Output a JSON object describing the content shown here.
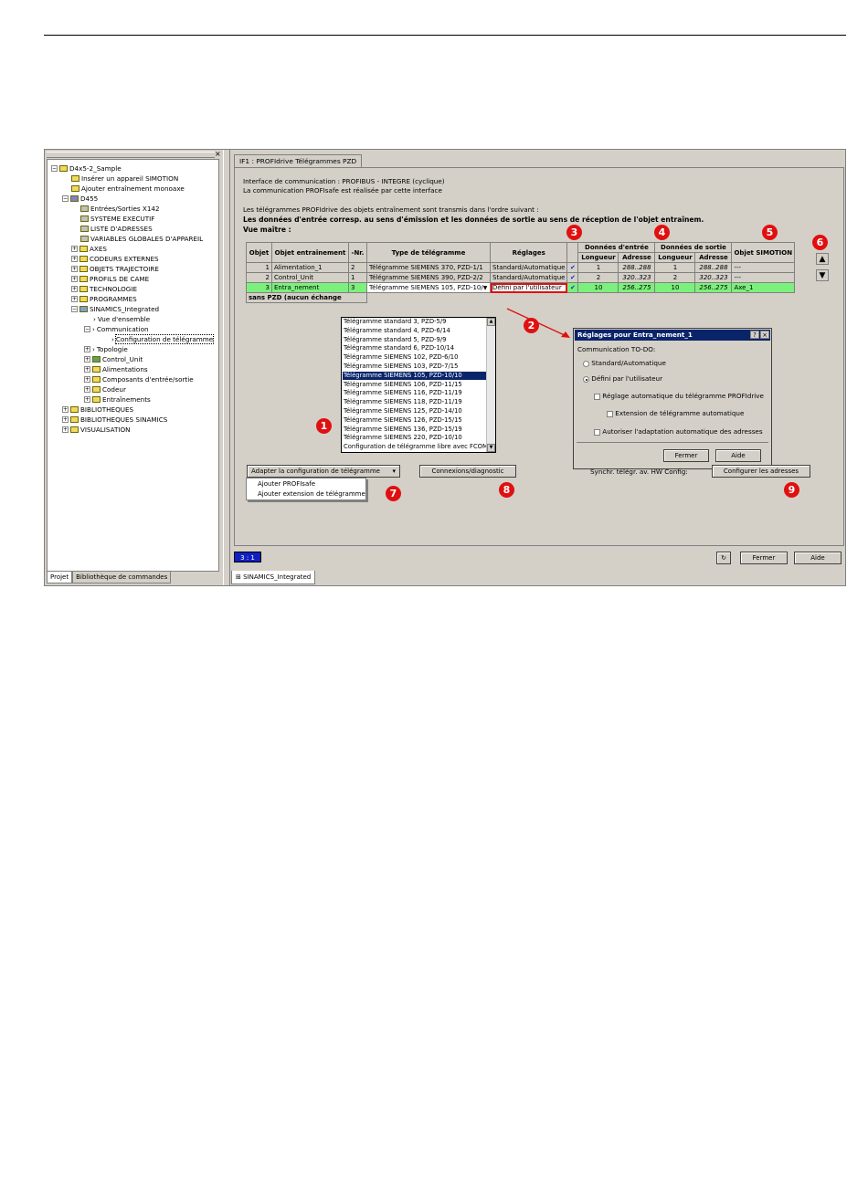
{
  "tree": {
    "items": [
      {
        "label": "D4x5-2_Sample"
      },
      {
        "label": "Insérer un appareil SIMOTION"
      },
      {
        "label": "Ajouter entraînement monoaxe"
      },
      {
        "label": "D455"
      },
      {
        "label": "Entrées/Sorties X142"
      },
      {
        "label": "SYSTEME EXECUTIF"
      },
      {
        "label": "LISTE D'ADRESSES"
      },
      {
        "label": "VARIABLES GLOBALES D'APPAREIL"
      },
      {
        "label": "AXES"
      },
      {
        "label": "CODEURS EXTERNES"
      },
      {
        "label": "OBJETS TRAJECTOIRE"
      },
      {
        "label": "PROFILS DE CAME"
      },
      {
        "label": "TECHNOLOGIE"
      },
      {
        "label": "PROGRAMMES"
      },
      {
        "label": "SINAMICS_Integrated"
      },
      {
        "label": "Vue d'ensemble"
      },
      {
        "label": "Communication"
      },
      {
        "label": "Configuration de télégramme"
      },
      {
        "label": "Topologie"
      },
      {
        "label": "Control_Unit"
      },
      {
        "label": "Alimentations"
      },
      {
        "label": "Composants d'entrée/sortie"
      },
      {
        "label": "Codeur"
      },
      {
        "label": "Entraînements"
      },
      {
        "label": "BIBLIOTHEQUES"
      },
      {
        "label": "BIBLIOTHEQUES SINAMICS"
      },
      {
        "label": "VISUALISATION"
      }
    ],
    "tabs": [
      "Projet",
      "Bibliothèque de commandes"
    ]
  },
  "right": {
    "tab_label": "IF1 : PROFIdrive Télégrammes PZD",
    "info1": "Interface de communication : PROFIBUS - INTEGRE (cyclique)",
    "info2": "La communication PROFIsafe est réalisée par cette interface",
    "info3": "Les télégrammes PROFIdrive des objets entraînement sont transmis dans l'ordre suivant :",
    "info4": "Les données d'entrée corresp. au sens d'émission et les données de sortie au sens de réception de l'objet entraînem.",
    "info5": "Vue maître :"
  },
  "table": {
    "headers": {
      "objet": "Objet",
      "objet_entr": "Objet entraînement",
      "nr": "-Nr.",
      "type": "Type de télégramme",
      "reglages": "Réglages",
      "donnees_entree": "Données d'entrée",
      "donnees_sortie": "Données de sortie",
      "longueur": "Longueur",
      "adresse": "Adresse",
      "objet_simotion": "Objet SIMOTION"
    },
    "rows": [
      {
        "objet": "1",
        "objet_entr": "Alimentation_1",
        "nr": "2",
        "type": "Télégramme SIEMENS 370, PZD-1/1",
        "reglages": "Standard/Automatique",
        "check": "✔",
        "lin": "1",
        "ain": "288..288",
        "lout": "1",
        "aout": "288..288",
        "sim": "---"
      },
      {
        "objet": "2",
        "objet_entr": "Control_Unit",
        "nr": "1",
        "type": "Télégramme SIEMENS 390, PZD-2/2",
        "reglages": "Standard/Automatique",
        "check": "✔",
        "lin": "2",
        "ain": "320..323",
        "lout": "2",
        "aout": "320..323",
        "sim": "---"
      },
      {
        "objet": "3",
        "objet_entr": "Entra_nement",
        "nr": "3",
        "type": "Télégramme SIEMENS 105, PZD-10/",
        "reglages": "Défini par l'utilisateur",
        "check": "✔",
        "lin": "10",
        "ain": "256..275",
        "lout": "10",
        "aout": "256..275",
        "sim": "Axe_1"
      }
    ],
    "last_row": "sans PZD (aucun échange"
  },
  "dropdown": {
    "items": [
      "Télégramme standard 3, PZD-5/9",
      "Télégramme standard 4, PZD-6/14",
      "Télégramme standard 5, PZD-9/9",
      "Télégramme standard 6, PZD-10/14",
      "Télégramme SIEMENS 102, PZD-6/10",
      "Télégramme SIEMENS 103, PZD-7/15",
      "Télégramme SIEMENS 105, PZD-10/10",
      "Télégramme SIEMENS 106, PZD-11/15",
      "Télégramme SIEMENS 116, PZD-11/19",
      "Télégramme SIEMENS 118, PZD-11/19",
      "Télégramme SIEMENS 125, PZD-14/10",
      "Télégramme SIEMENS 126, PZD-15/15",
      "Télégramme SIEMENS 136, PZD-15/19",
      "Télégramme SIEMENS 220, PZD-10/10",
      "Configuration de télégramme libre avec FCOM"
    ],
    "selected_index": 6
  },
  "dialog": {
    "title": "Réglages pour Entra_nement_1",
    "help_btn": "?",
    "close_btn": "×",
    "section": "Communication TO-DO:",
    "opt_standard": "Standard/Automatique",
    "opt_user": "Défini par l'utilisateur",
    "cb1": "Réglage automatique du télégramme PROFIdrive",
    "cb2": "Extension de télégramme automatique",
    "cb3": "Autoriser l'adaptation automatique des adresses",
    "btn_close": "Fermer",
    "btn_help": "Aide"
  },
  "buttons": {
    "adapt": "Adapter la configuration de télégramme",
    "connexions": "Connexions/diagnostic",
    "synch": "Synchr. télégr. av. HW Config:",
    "config_addr": "Configurer les adresses",
    "fermer": "Fermer",
    "aide": "Aide"
  },
  "menu": {
    "item1": "Ajouter PROFIsafe",
    "item2": "Ajouter extension de télégramme"
  },
  "status": {
    "value": "3 : 1",
    "bottom_tab": "SINAMICS_Integrated"
  },
  "badges": {
    "b1": "1",
    "b2": "2",
    "b3": "3",
    "b4": "4",
    "b5": "5",
    "b6": "6",
    "b7": "7",
    "b8": "8",
    "b9": "9"
  },
  "colors": {
    "badge": "#e01010",
    "title_bar": "#0a246a",
    "highlight_row": "#7cf07c"
  }
}
